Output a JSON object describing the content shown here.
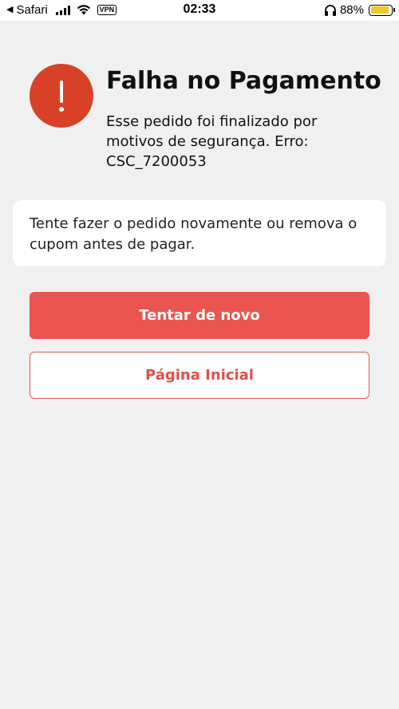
{
  "status_bar": {
    "back_app": "Safari",
    "vpn": "VPN",
    "time": "02:33",
    "battery_percent": "88%",
    "battery_level": 0.88,
    "battery_color": "#f5c52a"
  },
  "error": {
    "icon": "exclamation-icon",
    "title": "Falha no Pagamento",
    "message": "Esse pedido foi finalizado por motivos de segurança. Erro: CSC_7200053"
  },
  "info_card": {
    "text": "Tente fazer o pedido novamente ou remova o cupom antes de pagar."
  },
  "actions": {
    "retry_label": "Tentar de novo",
    "home_label": "Página Inicial"
  },
  "colors": {
    "error_red": "#d84027",
    "primary_button": "#eb5550",
    "secondary_border": "#e15a55",
    "background": "#f0f0f1"
  }
}
